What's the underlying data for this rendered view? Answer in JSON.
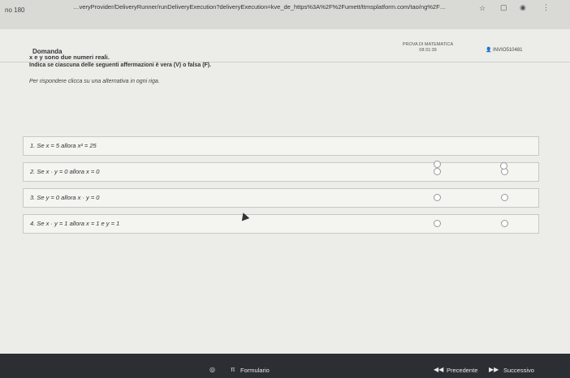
{
  "browser": {
    "tab_label": "no 180",
    "url": "…veryProvider/DeliveryRunner/runDeliveryExecution?deliveryExecution=kve_de_https%3A%2F%2Fumett/ttmsplatform.com/tao/ng%2F…"
  },
  "header": {
    "section": "Domanda",
    "test_name": "PROVA DI MATEMATICA",
    "timer": "08:31:39",
    "invio": "INVIO510481"
  },
  "question": {
    "intro": "x e y sono due numeri reali.",
    "instruction": "Indica se ciascuna delle seguenti affermazioni è vera (V) o falsa (F).",
    "hint": "Per rispondere clicca su una alternativa in ogni riga.",
    "col_v": "V",
    "col_f": "F",
    "rows": [
      "1. Se x = 5 allora x² = 25",
      "2. Se x · y = 0 allora x = 0",
      "3. Se y = 0 allora x · y = 0",
      "4. Se x · y = 1 allora x = 1 e y = 1"
    ]
  },
  "footer": {
    "formulario": "Formulario",
    "precedente": "Precedente",
    "successivo": "Successivo"
  }
}
